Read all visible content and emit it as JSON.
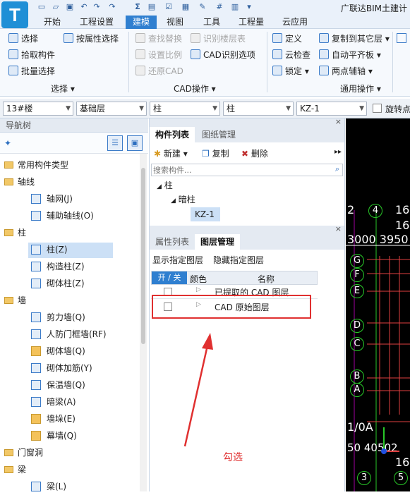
{
  "app": {
    "logo_letter": "T",
    "title": "广联达BIM土建计"
  },
  "menu": {
    "tabs": [
      "开始",
      "工程设置",
      "建模",
      "视图",
      "工具",
      "工程量",
      "云应用"
    ],
    "active": "建模"
  },
  "ribbon": {
    "select_group": {
      "items": [
        "选择",
        "按属性选择",
        "拾取构件",
        "批量选择"
      ],
      "label": "选择"
    },
    "cad_group": {
      "items": [
        "查找替换",
        "识别楼层表",
        "设置比例",
        "CAD识别选项",
        "还原CAD"
      ],
      "label": "CAD操作"
    },
    "general_group": {
      "items": [
        "定义",
        "复制到其它层",
        "云检查",
        "自动平齐板",
        "锁定",
        "两点辅轴"
      ],
      "label": "通用操作"
    }
  },
  "selbar": {
    "floor": "13#楼",
    "layer": "基础层",
    "type": "柱",
    "subtype": "柱",
    "name": "KZ-1",
    "rotate_label": "旋转点"
  },
  "nav": {
    "header": "导航树",
    "items": [
      {
        "label": "常用构件类型"
      },
      {
        "label": "轴线"
      },
      {
        "label": "轴网(J)"
      },
      {
        "label": "辅助轴线(O)"
      },
      {
        "label": "柱"
      },
      {
        "label": "柱(Z)"
      },
      {
        "label": "构造柱(Z)"
      },
      {
        "label": "砌体柱(Z)"
      },
      {
        "label": "墙"
      },
      {
        "label": "剪力墙(Q)"
      },
      {
        "label": "人防门框墙(RF)"
      },
      {
        "label": "砌体墙(Q)"
      },
      {
        "label": "砌体加筋(Y)"
      },
      {
        "label": "保温墙(Q)"
      },
      {
        "label": "暗梁(A)"
      },
      {
        "label": "墙垛(E)"
      },
      {
        "label": "幕墙(Q)"
      },
      {
        "label": "门窗洞"
      },
      {
        "label": "梁"
      },
      {
        "label": "梁(L)"
      }
    ]
  },
  "component_panel": {
    "tabs": [
      "构件列表",
      "图纸管理"
    ],
    "new_label": "新建",
    "copy_label": "复制",
    "delete_label": "删除",
    "search_placeholder": "搜索构件...",
    "tree": [
      "柱",
      "暗柱",
      "KZ-1"
    ]
  },
  "layer_panel": {
    "tabs": [
      "属性列表",
      "图层管理"
    ],
    "show_label": "显示指定图层",
    "hide_label": "隐藏指定图层",
    "columns": [
      "开 / 关",
      "颜色",
      "名称"
    ],
    "rows": [
      {
        "name": "已提取的 CAD 图层"
      },
      {
        "name": "CAD 原始图层"
      }
    ]
  },
  "annotation": {
    "text": "勾选",
    "color": "#e03030"
  },
  "canvas": {
    "top_labels": [
      "2",
      "4",
      "16"
    ],
    "dims": "3000 3950",
    "axis_letters": [
      "G",
      "F",
      "E",
      "D",
      "C",
      "B",
      "A"
    ],
    "axis_extra": "1/0A",
    "bottom_dims": "50 40502",
    "bottom_labels": [
      "3",
      "5"
    ]
  }
}
